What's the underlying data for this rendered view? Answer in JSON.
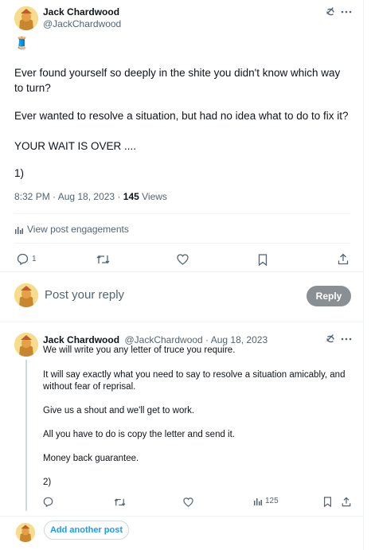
{
  "main_post": {
    "author_name": "Jack Chardwood",
    "author_handle": "@JackChardwood",
    "emoji": "🧵",
    "paragraphs": [
      "Ever found yourself so deeply in the shite you didn't know which way to turn?",
      "Ever wanted to resolve a situation, but had no idea what to do to fix it?",
      "YOUR WAIT IS OVER ....",
      "1)"
    ],
    "time": "8:32 PM · Aug 18, 2023 · ",
    "views_count": "145",
    "views_label": " Views",
    "engagements_label": "View post engagements",
    "reply_count": "1"
  },
  "reply_box": {
    "placeholder": "Post your reply",
    "button_label": "Reply"
  },
  "thread_post": {
    "author_name": "Jack Chardwood",
    "author_handle": "@JackChardwood",
    "dot_date": " · Aug 18, 2023",
    "first_line": "We will write you any letter of truce you require.",
    "paragraphs": [
      "It will say exactly what you need to say to resolve a situation amicably, and without fear of reprisal.",
      "Give us a shout and we'll get to work.",
      "All you have to do is copy the letter and send it.",
      "Money back guarantee.",
      "2)"
    ],
    "views_count": "125"
  },
  "add_post": {
    "button_label": "Add another post"
  },
  "colors": {
    "accent": "#1d9bf0",
    "muted": "#536471",
    "border": "#eff3f4",
    "reply_button_disabled": "#8a8f94"
  },
  "icons": [
    "grok-icon",
    "more-icon",
    "analytics-icon",
    "reply-icon",
    "repost-icon",
    "like-icon",
    "bookmark-icon",
    "share-icon"
  ]
}
